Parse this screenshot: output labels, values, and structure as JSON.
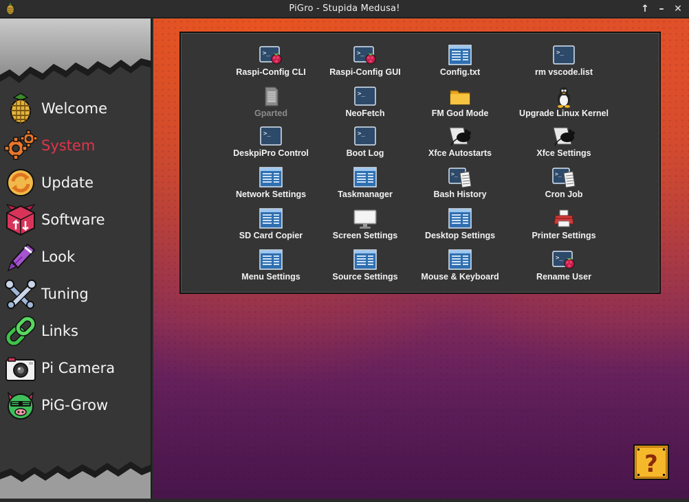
{
  "window": {
    "title": "PiGro - Stupida Medusa!",
    "controls": [
      "↑",
      "–",
      "✕"
    ]
  },
  "sidebar": {
    "items": [
      {
        "label": "Welcome",
        "icon": "pinecone-icon"
      },
      {
        "label": "System",
        "icon": "gears-icon",
        "active": true
      },
      {
        "label": "Update",
        "icon": "refresh-icon"
      },
      {
        "label": "Software",
        "icon": "package-icon"
      },
      {
        "label": "Look",
        "icon": "paintbrush-icon"
      },
      {
        "label": "Tuning",
        "icon": "wrench-icon"
      },
      {
        "label": "Links",
        "icon": "chain-link-icon"
      },
      {
        "label": "Pi Camera",
        "icon": "camera-icon"
      },
      {
        "label": "PiG-Grow",
        "icon": "pig-icon"
      }
    ]
  },
  "tools": [
    {
      "label": "Raspi-Config CLI",
      "icon": "terminal-raspberry-icon"
    },
    {
      "label": "Raspi-Config GUI",
      "icon": "terminal-raspberry-icon"
    },
    {
      "label": "Config.txt",
      "icon": "window-text-icon"
    },
    {
      "label": "rm vscode.list",
      "icon": "terminal-icon"
    },
    {
      "label": "Gparted",
      "icon": "sd-card-icon",
      "disabled": true
    },
    {
      "label": "NeoFetch",
      "icon": "terminal-icon"
    },
    {
      "label": "FM God Mode",
      "icon": "folder-icon"
    },
    {
      "label": "Upgrade Linux Kernel",
      "icon": "tux-icon"
    },
    {
      "label": "DeskpiPro Control",
      "icon": "terminal-icon"
    },
    {
      "label": "Boot Log",
      "icon": "terminal-icon"
    },
    {
      "label": "Xfce Autostarts",
      "icon": "xfce-mouse-icon"
    },
    {
      "label": "Xfce Settings",
      "icon": "xfce-mouse-icon"
    },
    {
      "label": "Network Settings",
      "icon": "window-text-icon"
    },
    {
      "label": "Taskmanager",
      "icon": "window-text-icon"
    },
    {
      "label": "Bash History",
      "icon": "terminal-document-icon"
    },
    {
      "label": "Cron Job",
      "icon": "terminal-document-icon"
    },
    {
      "label": "SD Card Copier",
      "icon": "window-text-icon"
    },
    {
      "label": "Screen Settings",
      "icon": "monitor-icon"
    },
    {
      "label": "Desktop Settings",
      "icon": "window-text-icon"
    },
    {
      "label": "Printer Settings",
      "icon": "printer-icon"
    },
    {
      "label": "Menu Settings",
      "icon": "window-text-icon"
    },
    {
      "label": "Source Settings",
      "icon": "window-text-icon"
    },
    {
      "label": "Mouse & Keyboard",
      "icon": "window-text-icon"
    },
    {
      "label": "Rename User",
      "icon": "terminal-raspberry-icon"
    }
  ],
  "mystery_box": {
    "glyph": "?",
    "icon": "question-block-icon"
  },
  "colors": {
    "active_nav": "#e0354a",
    "accent_orange": "#e95420",
    "panel_bg": "#353535",
    "sidebar_bg": "#363636"
  }
}
